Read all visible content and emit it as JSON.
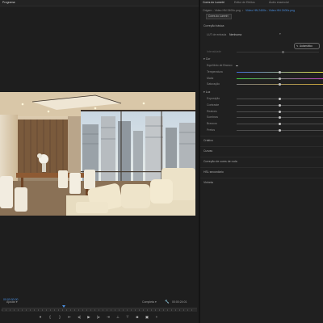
{
  "monitor": {
    "tab_title": "Programa",
    "tab_menu_icon": "hamburger-menu-icon",
    "fit_value": "Ajustar",
    "timecode_left": "00:00:00:00",
    "quality_value": "Completa",
    "wrench_icon": "wrench-icon",
    "timecode_right": "00:00:24:01",
    "transport": [
      {
        "name": "add-marker-button",
        "glyph": "▾"
      },
      {
        "name": "mark-in-button",
        "glyph": "{"
      },
      {
        "name": "mark-out-button",
        "glyph": "}"
      },
      {
        "name": "go-to-in-button",
        "glyph": "⇤"
      },
      {
        "name": "step-back-button",
        "glyph": "◂|"
      },
      {
        "name": "play-button",
        "glyph": "▶"
      },
      {
        "name": "step-forward-button",
        "glyph": "|▸"
      },
      {
        "name": "go-to-out-button",
        "glyph": "⇥"
      },
      {
        "name": "lift-button",
        "glyph": "⊥"
      },
      {
        "name": "extract-button",
        "glyph": "⊤"
      },
      {
        "name": "export-frame-button",
        "glyph": "◙"
      },
      {
        "name": "comparison-view-button",
        "glyph": "▣"
      },
      {
        "name": "add-button",
        "glyph": "+"
      }
    ]
  },
  "lumetri": {
    "tabs": [
      {
        "label": "Cores do Lumetri",
        "active": true
      },
      {
        "label": "Editor de Efeitos"
      },
      {
        "label": "Áudio essencial"
      }
    ],
    "breadcrumb_master": "Origem - Video HN 2400x.png",
    "breadcrumb_clip": "Vídeo HN 2400x - Video HN 2400x.png",
    "effect_tab": "Cores do Lumetri",
    "basic_correction": "Correção básica",
    "lut_label": "LUT de entrada",
    "lut_value": "Nenhuma",
    "auto_button": "Automático",
    "intensity_label": "Intensidade",
    "color_section": "Cor",
    "white_balance_label": "Equilíbrio de Branco",
    "color_sliders": [
      {
        "label": "Temperatura",
        "value": 0.5,
        "gradient": "#3f6bd8,#e6e640"
      },
      {
        "label": "Matiz",
        "value": 0.5,
        "gradient": "#3ed23e,#c640c6"
      },
      {
        "label": "Saturação",
        "value": 0.5,
        "gradient": "#777777,#c6a23a"
      }
    ],
    "light_section": "Luz",
    "light_sliders": [
      {
        "label": "Exposição",
        "value": 0.5
      },
      {
        "label": "Contraste",
        "value": 0.5
      },
      {
        "label": "Realces",
        "value": 0.5
      },
      {
        "label": "Sombras",
        "value": 0.5
      },
      {
        "label": "Brancos",
        "value": 0.5
      },
      {
        "label": "Pretos",
        "value": 0.5
      }
    ],
    "sections": [
      "Criativo",
      "Curvas",
      "Correção de cores de roda",
      "HSL secundário",
      "Vinheta"
    ]
  }
}
